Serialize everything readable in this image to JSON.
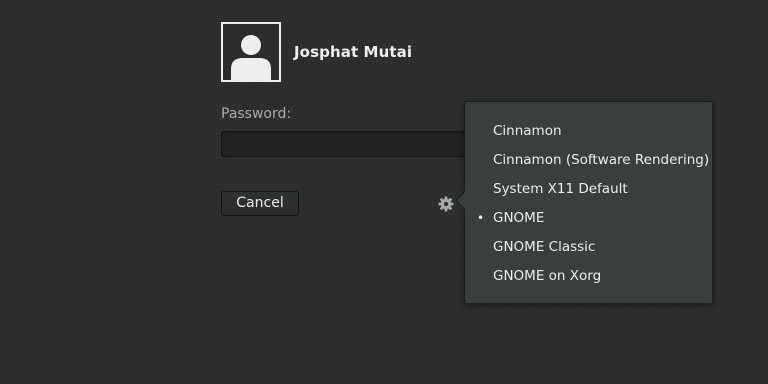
{
  "user": {
    "name": "Josphat Mutai"
  },
  "login": {
    "password_label": "Password:",
    "password_value": "",
    "cancel_label": "Cancel"
  },
  "session_menu": {
    "selected_marker": "•",
    "items": [
      {
        "label": "Cinnamon",
        "selected": false
      },
      {
        "label": "Cinnamon (Software Rendering)",
        "selected": false
      },
      {
        "label": "System X11 Default",
        "selected": false
      },
      {
        "label": "GNOME",
        "selected": true
      },
      {
        "label": "GNOME Classic",
        "selected": false
      },
      {
        "label": "GNOME on Xorg",
        "selected": false
      }
    ]
  },
  "icons": {
    "avatar": "user-avatar-icon",
    "session": "gear-icon"
  },
  "colors": {
    "background": "#2b2d2e",
    "text": "#eeeeec",
    "label": "#a8abaa",
    "popover": "#393f3f"
  }
}
